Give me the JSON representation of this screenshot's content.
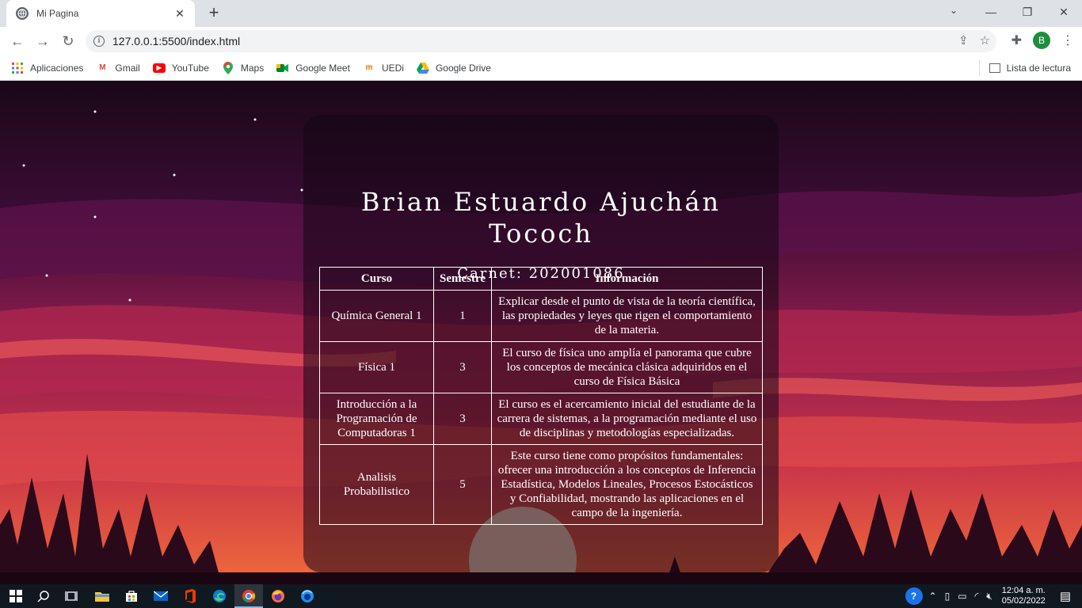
{
  "browser": {
    "tab_title": "Mi Pagina",
    "url": "127.0.0.1:5500/index.html",
    "bookmarks": [
      {
        "label": "Aplicaciones",
        "icon": "apps-grid-icon"
      },
      {
        "label": "Gmail",
        "icon": "gmail-icon"
      },
      {
        "label": "YouTube",
        "icon": "youtube-icon"
      },
      {
        "label": "Maps",
        "icon": "maps-icon"
      },
      {
        "label": "Google Meet",
        "icon": "meet-icon"
      },
      {
        "label": "UEDi",
        "icon": "uedi-icon"
      },
      {
        "label": "Google Drive",
        "icon": "drive-icon"
      }
    ],
    "reading_list": "Lista de lectura",
    "profile_initial": "B"
  },
  "page": {
    "name_line1": "Brian Estuardo Ajuchán",
    "name_line2": "Tococh",
    "carnet": "Carnet: 202001086",
    "table": {
      "headers": [
        "Curso",
        "Semestre",
        "Información"
      ],
      "rows": [
        {
          "curso": "Química General 1",
          "semestre": "1",
          "info": "Explicar desde el punto de vista de la teoría científica, las propiedades y leyes que rigen el comportamiento de la materia."
        },
        {
          "curso": "Física 1",
          "semestre": "3",
          "info": "El curso de física uno amplía el panorama que cubre los conceptos de mecánica clásica adquiridos en el curso de Física Básica"
        },
        {
          "curso": "Introducción a la Programación de Computadoras 1",
          "semestre": "3",
          "info": "El curso es el acercamiento inicial del estudiante de la carrera de sistemas, a la programación mediante el uso de disciplinas y metodologías especializadas."
        },
        {
          "curso": "Analisis Probabilistico",
          "semestre": "5",
          "info": "Este curso tiene como propósitos fundamentales: ofrecer una introducción a los conceptos de Inferencia Estadística, Modelos Lineales, Procesos Estocásticos y Confiabilidad, mostrando las aplicaciones en el campo de la ingeniería."
        }
      ]
    }
  },
  "taskbar": {
    "time": "12:04 a. m.",
    "date": "05/02/2022"
  },
  "colors": {
    "accent": "#1e8e3e",
    "sky_top": "#1a0a1e",
    "sky_mid": "#7a1a4a",
    "sunset": "#e04a3a"
  }
}
